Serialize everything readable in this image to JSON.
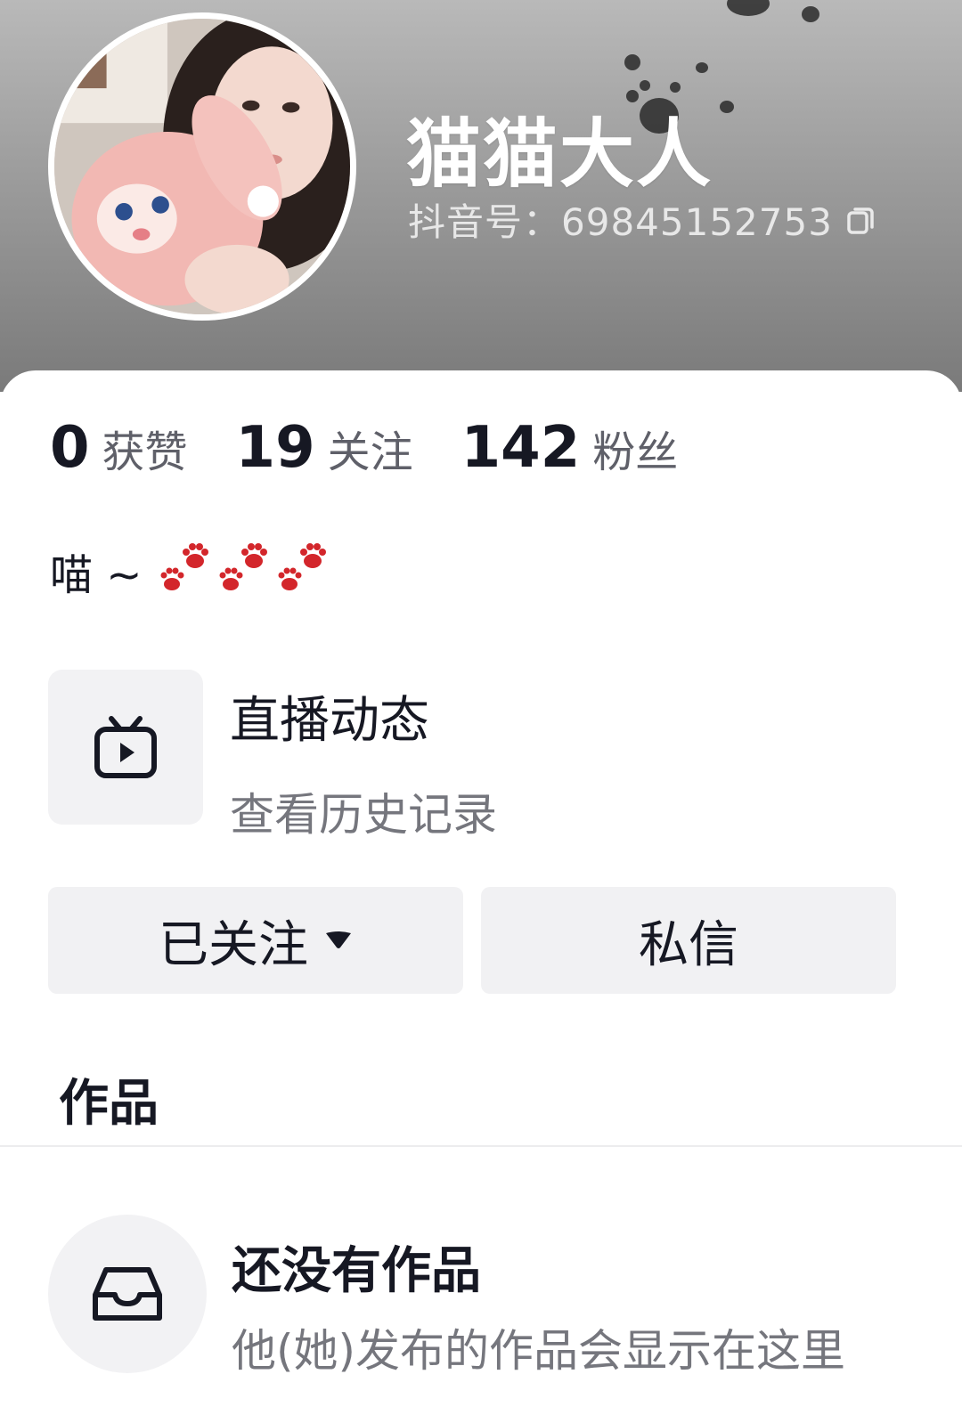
{
  "profile": {
    "nickname": "猫猫大人",
    "douyin_id": "抖音号：69845152753",
    "bio": "喵 ~",
    "bio_emoji": "paw-prints"
  },
  "stats": [
    {
      "value": "0",
      "label": "获赞"
    },
    {
      "value": "19",
      "label": "关注"
    },
    {
      "value": "142",
      "label": "粉丝"
    }
  ],
  "live": {
    "title": "直播动态",
    "subtitle": "查看历史记录",
    "icon": "tv-play-icon"
  },
  "actions": {
    "follow_label": "已关注",
    "message_label": "私信"
  },
  "tabs": {
    "works_label": "作品"
  },
  "empty_state": {
    "title": "还没有作品",
    "subtitle": "他(她)发布的作品会显示在这里",
    "icon": "inbox-icon"
  },
  "colors": {
    "header_gradient_top": "#b9b9b9",
    "header_gradient_bottom": "#7a7a7a",
    "paw_red": "#d3262b",
    "button_bg": "#f1f1f3",
    "text_primary": "#161823",
    "text_secondary": "#75767d"
  }
}
